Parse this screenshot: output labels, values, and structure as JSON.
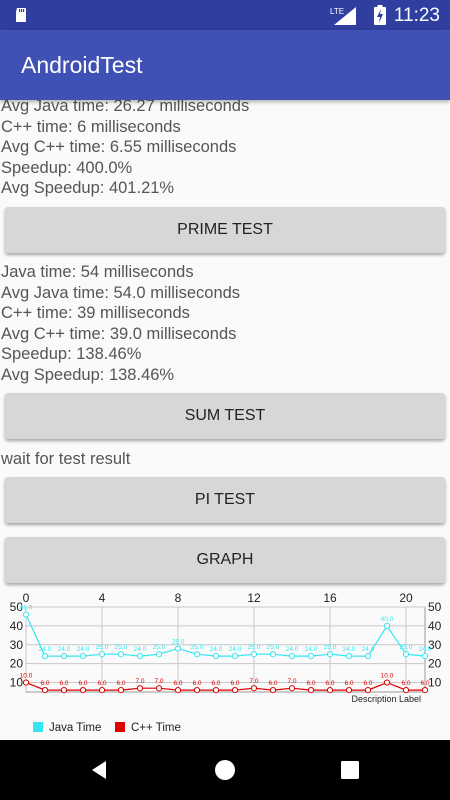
{
  "status_bar": {
    "time": "11:23",
    "network": "LTE",
    "icons": [
      "sd-card-icon",
      "signal-icon",
      "battery-icon"
    ]
  },
  "app_bar": {
    "title": "AndroidTest"
  },
  "section1": {
    "lines": [
      "Avg Java time: 26.27 milliseconds",
      "C++ time: 6 milliseconds",
      "Avg C++ time: 6.55 milliseconds",
      "Speedup: 400.0%",
      "Avg Speedup: 401.21%"
    ]
  },
  "buttons": {
    "prime": "PRIME TEST",
    "sum": "SUM TEST",
    "pi": "PI TEST",
    "graph": "GRAPH"
  },
  "section2": {
    "lines": [
      "Java time: 54 milliseconds",
      "Avg Java time: 54.0 milliseconds",
      "C++ time: 39 milliseconds",
      "Avg C++ time: 39.0 milliseconds",
      "Speedup: 138.46%",
      "Avg Speedup: 138.46%"
    ]
  },
  "wait_text": "wait for test result",
  "chart_data": {
    "type": "line",
    "x": [
      0,
      1,
      2,
      3,
      4,
      5,
      6,
      7,
      8,
      9,
      10,
      11,
      12,
      13,
      14,
      15,
      16,
      17,
      18,
      19,
      20,
      21
    ],
    "x_ticks": [
      0,
      4,
      8,
      12,
      16,
      20
    ],
    "y_ticks": [
      10,
      20,
      30,
      40,
      50
    ],
    "ylim": [
      5,
      50
    ],
    "series": [
      {
        "name": "Java Time",
        "color": "#33e6f2",
        "values": [
          46.0,
          24.0,
          24.0,
          24.0,
          25.0,
          25.0,
          24.0,
          25.0,
          28.0,
          25.0,
          24.0,
          24.0,
          25.0,
          25.0,
          24.0,
          24.0,
          25.0,
          24.0,
          24.0,
          40.0,
          25.0,
          24.0
        ],
        "value_labels": [
          "46.0",
          "24.0",
          "24.0",
          "24.0",
          "25.0",
          "25.0",
          "24.0",
          "25.0",
          "28.0",
          "25.0",
          "24.0",
          "24.0",
          "25.0",
          "25.0",
          "24.0",
          "24.0",
          "25.0",
          "24.0",
          "24.0",
          "40.0",
          "25.0",
          "24.0"
        ]
      },
      {
        "name": "C++ Time",
        "color": "#e00000",
        "values": [
          10.0,
          6.0,
          6.0,
          6.0,
          6.0,
          6.0,
          7.0,
          7.0,
          6.0,
          6.0,
          6.0,
          6.0,
          7.0,
          6.0,
          7.0,
          6.0,
          6.0,
          6.0,
          6.0,
          10.0,
          6.0,
          6.0
        ],
        "value_labels": [
          "10.0",
          "6.0",
          "6.0",
          "6.0",
          "6.0",
          "6.0",
          "7.0",
          "7.0",
          "6.0",
          "6.0",
          "6.0",
          "6.0",
          "7.0",
          "6.0",
          "7.0",
          "6.0",
          "6.0",
          "6.0",
          "6.0",
          "10.0",
          "6.0",
          "6.0"
        ]
      }
    ],
    "description_label": "Description Label",
    "legend_position": "bottom-left",
    "grid": true
  }
}
